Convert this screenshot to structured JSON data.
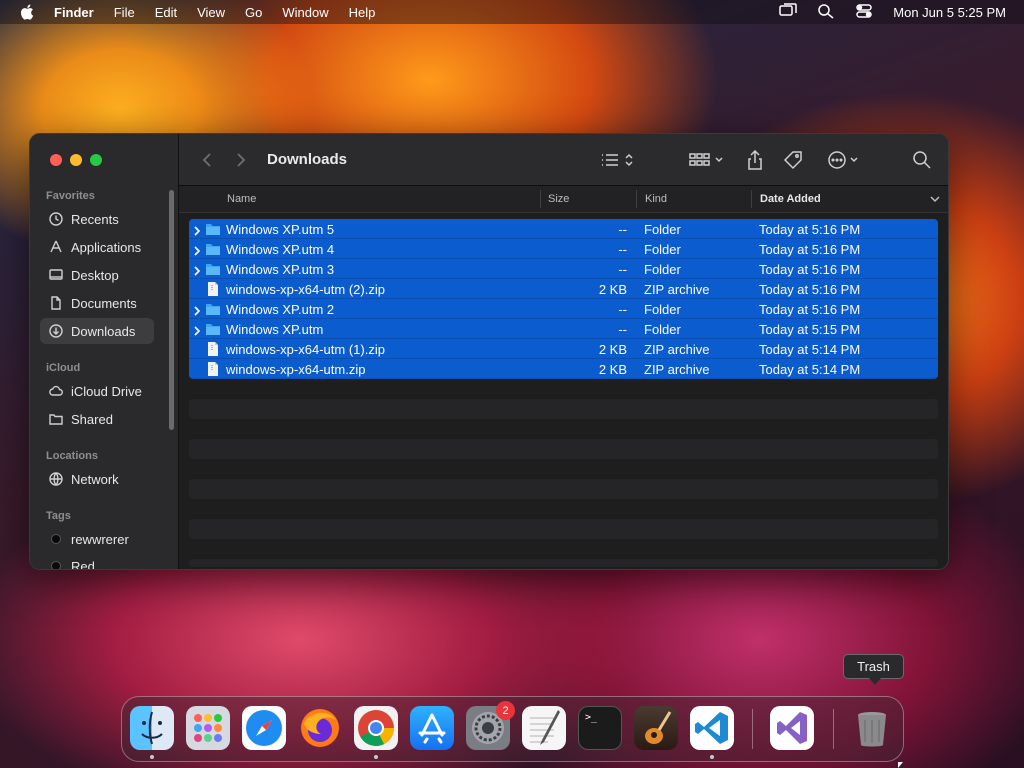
{
  "menubar": {
    "app_name": "Finder",
    "items": [
      "File",
      "Edit",
      "View",
      "Go",
      "Window",
      "Help"
    ],
    "clock": "Mon Jun 5  5:25 PM"
  },
  "window": {
    "title": "Downloads",
    "sidebar": {
      "favorites_label": "Favorites",
      "favorites": [
        "Recents",
        "Applications",
        "Desktop",
        "Documents",
        "Downloads"
      ],
      "icloud_label": "iCloud",
      "icloud": [
        "iCloud Drive",
        "Shared"
      ],
      "locations_label": "Locations",
      "locations": [
        "Network"
      ],
      "tags_label": "Tags",
      "tags": [
        "rewwrerer",
        "Red"
      ]
    },
    "columns": {
      "name": "Name",
      "size": "Size",
      "kind": "Kind",
      "date": "Date Added"
    },
    "files": [
      {
        "name": "Windows XP.utm 5",
        "size": "--",
        "kind": "Folder",
        "date": "Today at 5:16 PM",
        "type": "folder"
      },
      {
        "name": "Windows XP.utm 4",
        "size": "--",
        "kind": "Folder",
        "date": "Today at 5:16 PM",
        "type": "folder"
      },
      {
        "name": "Windows XP.utm 3",
        "size": "--",
        "kind": "Folder",
        "date": "Today at 5:16 PM",
        "type": "folder"
      },
      {
        "name": "windows-xp-x64-utm (2).zip",
        "size": "2 KB",
        "kind": "ZIP archive",
        "date": "Today at 5:16 PM",
        "type": "file"
      },
      {
        "name": "Windows XP.utm 2",
        "size": "--",
        "kind": "Folder",
        "date": "Today at 5:16 PM",
        "type": "folder"
      },
      {
        "name": "Windows XP.utm",
        "size": "--",
        "kind": "Folder",
        "date": "Today at 5:15 PM",
        "type": "folder"
      },
      {
        "name": "windows-xp-x64-utm (1).zip",
        "size": "2 KB",
        "kind": "ZIP archive",
        "date": "Today at 5:14 PM",
        "type": "file"
      },
      {
        "name": "windows-xp-x64-utm.zip",
        "size": "2 KB",
        "kind": "ZIP archive",
        "date": "Today at 5:14 PM",
        "type": "file"
      }
    ]
  },
  "dock": {
    "tooltip": "Trash",
    "settings_badge": "2",
    "terminal_prompt": ">_"
  },
  "colors": {
    "selection": "#0b5ccf",
    "folder": "#3ea6f2"
  }
}
